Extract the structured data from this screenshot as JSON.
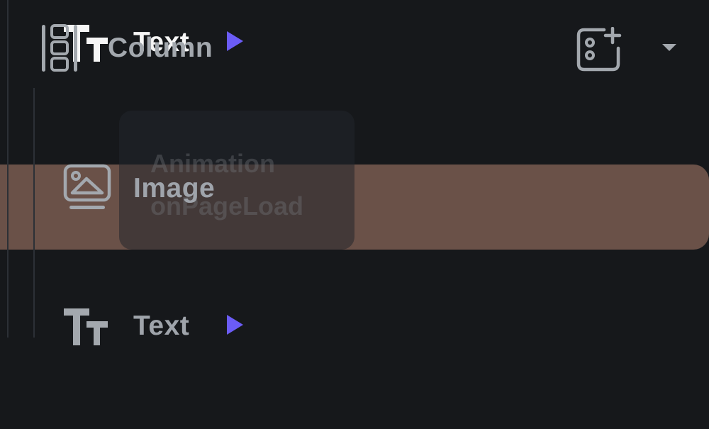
{
  "tree": {
    "column": {
      "label": "Column",
      "icon": "column-layout-icon"
    },
    "items": [
      {
        "label": "Image",
        "icon": "image-icon"
      },
      {
        "label": "Text",
        "icon": "text-type-icon"
      },
      {
        "label": "Text",
        "icon": "text-type-icon",
        "selected": true
      }
    ],
    "actions": {
      "add_icon": "add-child-widget-icon",
      "dropdown_icon": "caret-down-icon"
    }
  },
  "tooltip": {
    "title": "Animation",
    "subtitle": "onPageLoad"
  },
  "colors": {
    "background": "#16181b",
    "selected_row": "#6a5148",
    "play_accent": "#6b5cf6",
    "muted_text": "#9fa4ab",
    "selected_text": "#f6f6f6"
  }
}
